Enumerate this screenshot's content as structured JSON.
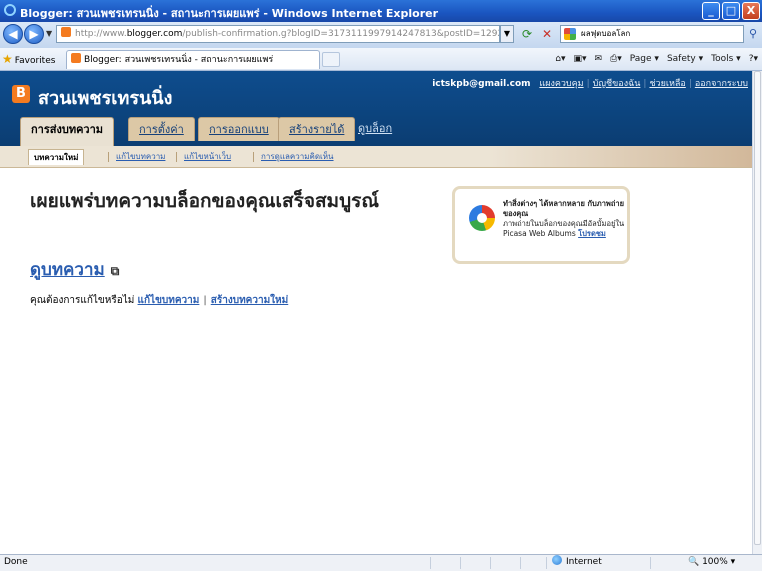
{
  "window": {
    "title": "Blogger: สวนเพชรเทรนนิ่ง - สถานะการเผยแพร่ - Windows Internet Explorer",
    "controls": [
      "_",
      "□",
      "X"
    ]
  },
  "address_bar": {
    "url_prefix": "http://www.",
    "url_domain": "blogger.com",
    "url_rest": "/publish-confirmation.g?blogID=3173111997914247813&postID=1292974427013108",
    "search_text": "ผลฟุตบอลโลก"
  },
  "favorites_bar": {
    "favorites_label": "Favorites",
    "tab_title": "Blogger: สวนเพชรเทรนนิ่ง - สถานะการเผยแพร่",
    "page_label": "Page",
    "safety_label": "Safety",
    "tools_label": "Tools"
  },
  "blogger": {
    "logo_letter": "B",
    "blog_title": "สวนเพชรเทรนนิ่ง",
    "email": "ictskpb@gmail.com",
    "top_links": [
      "แผงควบคุม",
      "บัญชีของฉัน",
      "ช่วยเหลือ",
      "ออกจากระบบ"
    ],
    "main_tabs": [
      "การส่งบทความ",
      "การตั้งค่า",
      "การออกแบบ",
      "สร้างรายได้",
      "ดูบล็อก"
    ],
    "sub_tabs": [
      "บทความใหม่",
      "แก้ไขบทความ",
      "แก้ไขหน้าเว็บ",
      "การดูแลความคิดเห็น"
    ]
  },
  "main": {
    "heading": "เผยแพร่บทความบล็อกของคุณเสร็จสมบูรณ์",
    "view_post": "ดูบทความ",
    "ask_prefix": "คุณต้องการแก้ไขหรือไม่",
    "edit_post_link": "แก้ไขบทความ",
    "separator": "|",
    "new_post_link": "สร้างบทความใหม่"
  },
  "picasa": {
    "line1": "ทำสิ่งต่างๆ ได้หลากหลาย กับภาพถ่ายของคุณ",
    "line2": "ภาพถ่ายในบล็อกของคุณมีอัลบั้มอยู่ใน Picasa Web Albums",
    "link": "โปรดชม"
  },
  "status_bar": {
    "status": "Done",
    "zone": "Internet",
    "zoom": "100%"
  },
  "colors": {
    "blogger_header": "#0e4d8e",
    "blogger_orange": "#f47b20",
    "link_blue": "#2a5db0",
    "ie_title": "#1a55c0"
  }
}
